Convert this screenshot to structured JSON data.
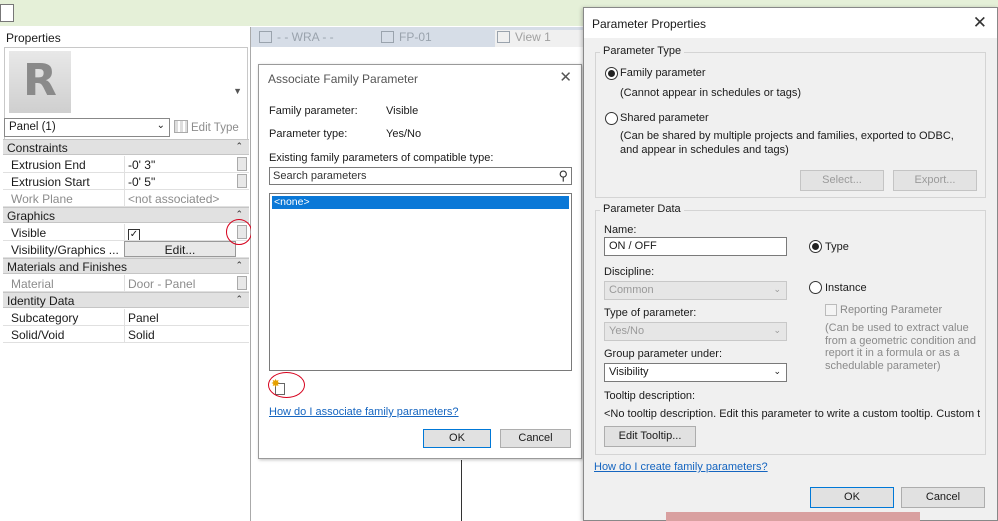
{
  "properties": {
    "title": "Properties",
    "logo_letter": "R",
    "type_selector": "Panel (1)",
    "edit_type": "Edit Type",
    "groups": [
      {
        "name": "Constraints"
      },
      {
        "name": "Graphics"
      },
      {
        "name": "Materials and Finishes"
      },
      {
        "name": "Identity Data"
      }
    ],
    "rows": {
      "extrusion_end": {
        "key": "Extrusion End",
        "value": "-0'  3\""
      },
      "extrusion_start": {
        "key": "Extrusion Start",
        "value": "-0'  5\""
      },
      "work_plane": {
        "key": "Work Plane",
        "value": "<not associated>"
      },
      "visible": {
        "key": "Visible",
        "checked": true
      },
      "visibility_graphics": {
        "key": "Visibility/Graphics ...",
        "value": "Edit..."
      },
      "material": {
        "key": "Material",
        "value": "Door - Panel"
      },
      "subcategory": {
        "key": "Subcategory",
        "value": "Panel"
      },
      "solid_void": {
        "key": "Solid/Void",
        "value": "Solid"
      }
    }
  },
  "view_tabs": [
    {
      "label": "- - WRA - -"
    },
    {
      "label": "FP-01"
    },
    {
      "label": "View 1"
    }
  ],
  "assoc_dialog": {
    "title": "Associate Family Parameter",
    "family_parameter_label": "Family parameter:",
    "family_parameter_value": "Visible",
    "parameter_type_label": "Parameter type:",
    "parameter_type_value": "Yes/No",
    "existing_label": "Existing family parameters of compatible type:",
    "search_placeholder": "Search parameters",
    "list_items": [
      "<none>"
    ],
    "help_link": "How do I associate family parameters?",
    "ok": "OK",
    "cancel": "Cancel"
  },
  "param_props": {
    "title": "Parameter Properties",
    "parameter_type_legend": "Parameter Type",
    "family_parameter": "Family parameter",
    "family_parameter_note": "(Cannot appear in schedules or tags)",
    "shared_parameter": "Shared parameter",
    "shared_parameter_note": "(Can be shared by multiple projects and families, exported to ODBC, and appear in schedules and tags)",
    "select_button": "Select...",
    "export_button": "Export...",
    "parameter_data_legend": "Parameter Data",
    "name_label": "Name:",
    "name_value": "ON / OFF",
    "type_radio": "Type",
    "instance_radio": "Instance",
    "reporting_parameter": "Reporting Parameter",
    "reporting_note": "(Can be used to extract value from a geometric condition and report it in a formula or as a schedulable parameter)",
    "discipline_label": "Discipline:",
    "discipline_value": "Common",
    "type_of_parameter_label": "Type of parameter:",
    "type_of_parameter_value": "Yes/No",
    "group_under_label": "Group parameter under:",
    "group_under_value": "Visibility",
    "tooltip_label": "Tooltip description:",
    "tooltip_value": "<No tooltip description. Edit this parameter to write a custom tooltip. Custom t...",
    "edit_tooltip": "Edit Tooltip...",
    "help_link": "How do I create family parameters?",
    "ok": "OK",
    "cancel": "Cancel"
  }
}
